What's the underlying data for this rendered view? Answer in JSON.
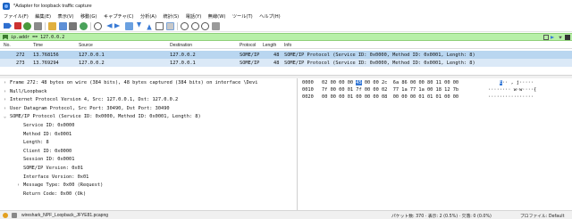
{
  "window": {
    "title": "*Adapter for loopback traffic capture"
  },
  "menu": [
    "ファイル(F)",
    "編集(E)",
    "表示(V)",
    "移動(G)",
    "キャプチャ(C)",
    "分析(A)",
    "統計(S)",
    "電話(Y)",
    "無線(W)",
    "ツール(T)",
    "ヘルプ(H)"
  ],
  "filter": {
    "value": "ip.addr == 127.0.0.2"
  },
  "packet_list": {
    "columns": [
      "No.",
      "Time",
      "Source",
      "Destination",
      "Protocol",
      "Length",
      "Info"
    ],
    "rows": [
      {
        "no": "272",
        "time": "13.768156",
        "source": "127.0.0.1",
        "destination": "127.0.0.2",
        "protocol": "SOME/IP",
        "length": "48",
        "info": "SOME/IP Protocol (Service ID: 0x0000, Method ID: 0x0001, Length: 8)"
      },
      {
        "no": "273",
        "time": "13.769294",
        "source": "127.0.0.2",
        "destination": "127.0.0.1",
        "protocol": "SOME/IP",
        "length": "48",
        "info": "SOME/IP Protocol (Service ID: 0x0000, Method ID: 0x0001, Length: 8)"
      }
    ]
  },
  "details": [
    {
      "indent": 0,
      "arrow": "›",
      "text": "Frame 272: 48 bytes on wire (384 bits), 48 bytes captured (384 bits) on interface \\Devi"
    },
    {
      "indent": 0,
      "arrow": "›",
      "text": "Null/Loopback"
    },
    {
      "indent": 0,
      "arrow": "›",
      "text": "Internet Protocol Version 4, Src: 127.0.0.1, Dst: 127.0.0.2"
    },
    {
      "indent": 0,
      "arrow": "›",
      "text": "User Datagram Protocol, Src Port: 30490, Dst Port: 30490"
    },
    {
      "indent": 0,
      "arrow": "⌄",
      "text": "SOME/IP Protocol (Service ID: 0x0000, Method ID: 0x0001, Length: 8)"
    },
    {
      "indent": 1,
      "arrow": "",
      "text": "Service ID: 0x0000"
    },
    {
      "indent": 1,
      "arrow": "",
      "text": "Method ID: 0x0001"
    },
    {
      "indent": 1,
      "arrow": "",
      "text": "Length: 8"
    },
    {
      "indent": 1,
      "arrow": "",
      "text": "Client ID: 0x0000"
    },
    {
      "indent": 1,
      "arrow": "",
      "text": "Session ID: 0x0001"
    },
    {
      "indent": 1,
      "arrow": "",
      "text": "SOME/IP Version: 0x01"
    },
    {
      "indent": 1,
      "arrow": "",
      "text": "Interface Version: 0x01"
    },
    {
      "indent": 1,
      "arrow": "›",
      "text": "Message Type: 0x00 (Request)"
    },
    {
      "indent": 1,
      "arrow": "",
      "text": "Return Code: 0x00 (Ok)"
    }
  ],
  "hex": [
    {
      "offset": "0000",
      "pre": "02 00 00 00 ",
      "sel": "45",
      "post": " 00 00 2c  6a 86 00 00 80 11 00 00",
      "ascii_pre": "    ",
      "ascii_sel": "E",
      "ascii_post": "·· , j·····"
    },
    {
      "offset": "0010",
      "pre": "7f 00 00 01 7f 00 00 02  77 1a 77 1a 00 18 12 7b",
      "sel": "",
      "post": "",
      "ascii_pre": "········ w·w····{",
      "ascii_sel": "",
      "ascii_post": ""
    },
    {
      "offset": "0020",
      "pre": "00 00 00 01 00 00 00 08  00 00 00 01 01 01 00 00",
      "sel": "",
      "post": "",
      "ascii_pre": "················",
      "ascii_sel": "",
      "ascii_post": ""
    }
  ],
  "status": {
    "file": "wireshark_NPF_Loopback_JFYE81.pcapng",
    "stats": "パケット数: 370 · 表示: 2 (0.5%) · 欠落: 0 (0.0%)",
    "profile": "プロファイル: Default"
  },
  "colors": {
    "filter_bg": "#b7f0a8",
    "row_selected": "#b9d6f0",
    "row_related": "#dbe9f7",
    "hex_highlight": "#3478d6"
  }
}
